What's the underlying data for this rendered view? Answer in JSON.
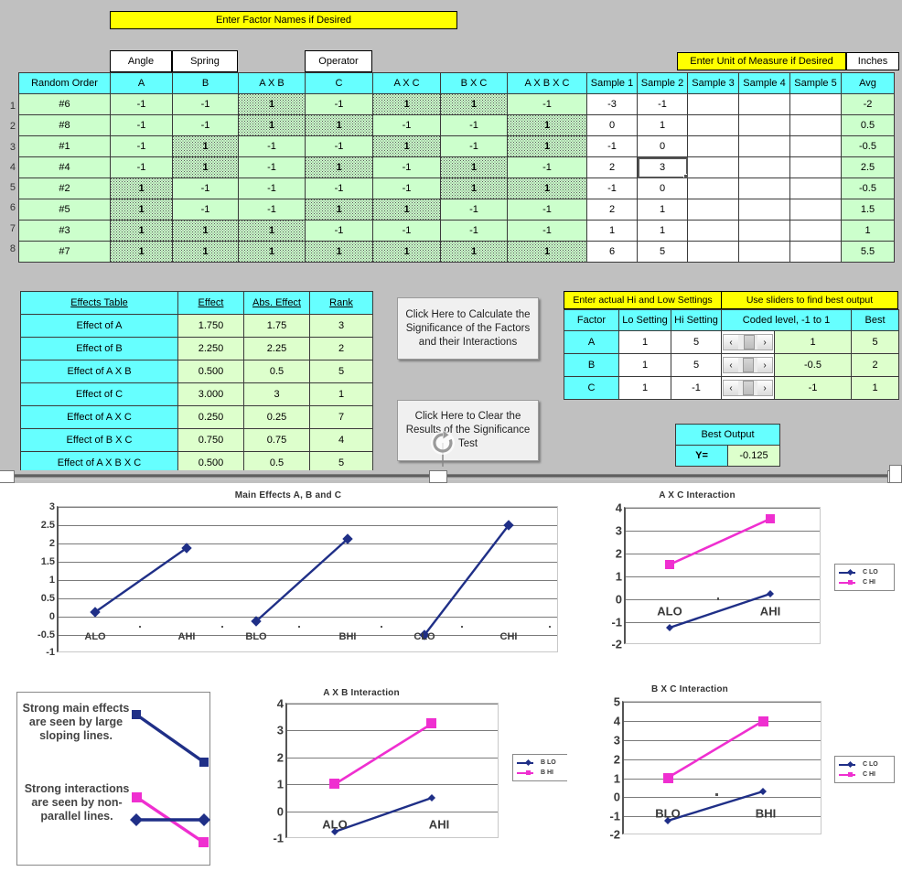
{
  "sheet": {
    "factor_names_banner": "Enter Factor Names if Desired",
    "unit_banner": "Enter Unit of Measure if Desired",
    "unit_value": "Inches",
    "factor_names": {
      "a": "Angle",
      "b": "Spring",
      "c": "Operator"
    },
    "columns": [
      "Random Order",
      "A",
      "B",
      "A X B",
      "C",
      "A X C",
      "B X C",
      "A X B X C",
      "Sample 1",
      "Sample 2",
      "Sample 3",
      "Sample 4",
      "Sample 5",
      "Avg"
    ],
    "row_numbers": [
      "1",
      "2",
      "3",
      "4",
      "5",
      "6",
      "7",
      "8"
    ],
    "rows": [
      {
        "order": "#6",
        "a": "-1",
        "b": "-1",
        "ab": "1",
        "c": "-1",
        "ac": "1",
        "bc": "1",
        "abc": "-1",
        "s1": "-3",
        "s2": "-1",
        "s3": "",
        "s4": "",
        "s5": "",
        "avg": "-2"
      },
      {
        "order": "#8",
        "a": "-1",
        "b": "-1",
        "ab": "1",
        "c": "1",
        "ac": "-1",
        "bc": "-1",
        "abc": "1",
        "s1": "0",
        "s2": "1",
        "s3": "",
        "s4": "",
        "s5": "",
        "avg": "0.5"
      },
      {
        "order": "#1",
        "a": "-1",
        "b": "1",
        "ab": "-1",
        "c": "-1",
        "ac": "1",
        "bc": "-1",
        "abc": "1",
        "s1": "-1",
        "s2": "0",
        "s3": "",
        "s4": "",
        "s5": "",
        "avg": "-0.5"
      },
      {
        "order": "#4",
        "a": "-1",
        "b": "1",
        "ab": "-1",
        "c": "1",
        "ac": "-1",
        "bc": "1",
        "abc": "-1",
        "s1": "2",
        "s2": "3",
        "s3": "",
        "s4": "",
        "s5": "",
        "avg": "2.5"
      },
      {
        "order": "#2",
        "a": "1",
        "b": "-1",
        "ab": "-1",
        "c": "-1",
        "ac": "-1",
        "bc": "1",
        "abc": "1",
        "s1": "-1",
        "s2": "0",
        "s3": "",
        "s4": "",
        "s5": "",
        "avg": "-0.5"
      },
      {
        "order": "#5",
        "a": "1",
        "b": "-1",
        "ab": "-1",
        "c": "1",
        "ac": "1",
        "bc": "-1",
        "abc": "-1",
        "s1": "2",
        "s2": "1",
        "s3": "",
        "s4": "",
        "s5": "",
        "avg": "1.5"
      },
      {
        "order": "#3",
        "a": "1",
        "b": "1",
        "ab": "1",
        "c": "-1",
        "ac": "-1",
        "bc": "-1",
        "abc": "-1",
        "s1": "1",
        "s2": "1",
        "s3": "",
        "s4": "",
        "s5": "",
        "avg": "1"
      },
      {
        "order": "#7",
        "a": "1",
        "b": "1",
        "ab": "1",
        "c": "1",
        "ac": "1",
        "bc": "1",
        "abc": "1",
        "s1": "6",
        "s2": "5",
        "s3": "",
        "s4": "",
        "s5": "",
        "avg": "5.5"
      }
    ],
    "selected_cell": {
      "row": 4,
      "column": "Sample 2",
      "value": "3"
    }
  },
  "effects_table": {
    "headers": [
      "Effects Table",
      "Effect",
      "Abs. Effect",
      "Rank"
    ],
    "rows": [
      {
        "label": "Effect of  A",
        "effect": "1.750",
        "abs": "1.75",
        "rank": "3"
      },
      {
        "label": "Effect of  B",
        "effect": "2.250",
        "abs": "2.25",
        "rank": "2"
      },
      {
        "label": "Effect of  A X B",
        "effect": "0.500",
        "abs": "0.5",
        "rank": "5"
      },
      {
        "label": "Effect of  C",
        "effect": "3.000",
        "abs": "3",
        "rank": "1"
      },
      {
        "label": "Effect of  A X C",
        "effect": "0.250",
        "abs": "0.25",
        "rank": "7"
      },
      {
        "label": "Effect of  B X C",
        "effect": "0.750",
        "abs": "0.75",
        "rank": "4"
      },
      {
        "label": "Effect of  A X B X C",
        "effect": "0.500",
        "abs": "0.5",
        "rank": "5"
      }
    ]
  },
  "buttons": {
    "calculate": "Click Here to Calculate the Significance of the Factors and their Interactions",
    "clear": "Click Here to Clear the Results of the Significance Test"
  },
  "settings": {
    "banner_left": "Enter actual Hi and Low Settings",
    "banner_right": "Use sliders to find best output",
    "headers": [
      "Factor",
      "Lo Setting",
      "Hi Setting",
      "Coded level, -1 to 1",
      "Best"
    ],
    "rows": [
      {
        "factor": "A",
        "lo": "1",
        "hi": "5",
        "coded": "1",
        "best": "5"
      },
      {
        "factor": "B",
        "lo": "1",
        "hi": "5",
        "coded": "-0.5",
        "best": "2"
      },
      {
        "factor": "C",
        "lo": "1",
        "hi": "-1",
        "coded": "-1",
        "best": "1"
      }
    ],
    "slider_icons": {
      "left": "‹",
      "right": "›"
    }
  },
  "best_output": {
    "title": "Best Output",
    "label": "Y=",
    "value": "-0.125"
  },
  "note_box": {
    "line1": "Strong main effects are seen by large sloping lines.",
    "line2": "Strong interactions are seen by non-parallel lines."
  },
  "colors": {
    "series_lo": "#1f2f87",
    "series_hi": "#ef2fd0",
    "header_cyan": "#66ffff",
    "cell_green": "#ccffcc",
    "banner_yellow": "#ffff00",
    "app_gray": "#c0c0c0"
  },
  "chart_data": [
    {
      "type": "line",
      "title": "Main Effects A, B and C",
      "xlabel": "",
      "ylabel": "",
      "ylim": [
        -1,
        3
      ],
      "yticks": [
        -1,
        -0.5,
        0,
        0.5,
        1,
        1.5,
        2,
        2.5,
        3
      ],
      "ytick_labels": [
        "-1",
        "-0.5",
        "0",
        "0.5",
        "1",
        "1.5",
        "2",
        "2.5",
        "3"
      ],
      "grid": true,
      "legend": "none",
      "categories": [
        "ALO",
        "AHI",
        "BLO",
        "BHI",
        "CLO",
        "CHI"
      ],
      "series": [
        {
          "name": "A",
          "color": "#1f2f87",
          "x": [
            "ALO",
            "AHI"
          ],
          "values": [
            0.125,
            1.875
          ]
        },
        {
          "name": "B",
          "color": "#1f2f87",
          "x": [
            "BLO",
            "BHI"
          ],
          "values": [
            -0.125,
            2.125
          ]
        },
        {
          "name": "C",
          "color": "#1f2f87",
          "x": [
            "CLO",
            "CHI"
          ],
          "values": [
            -0.5,
            2.5
          ]
        }
      ]
    },
    {
      "type": "line",
      "title": "A X C Interaction",
      "xlabel": "",
      "ylabel": "",
      "ylim": [
        -2,
        4
      ],
      "yticks": [
        -2,
        -1,
        0,
        1,
        2,
        3,
        4
      ],
      "ytick_labels": [
        "-2",
        "-1",
        "0",
        "1",
        "2",
        "3",
        "4"
      ],
      "grid": true,
      "legend": "right",
      "categories": [
        "ALO",
        "AHI"
      ],
      "series": [
        {
          "name": "C LO",
          "color": "#1f2f87",
          "values": [
            -1.25,
            0.25
          ]
        },
        {
          "name": "C HI",
          "color": "#ef2fd0",
          "values": [
            1.5,
            3.5
          ]
        }
      ]
    },
    {
      "type": "line",
      "title": "A X B Interaction",
      "xlabel": "",
      "ylabel": "",
      "ylim": [
        -1,
        4
      ],
      "yticks": [
        -1,
        0,
        1,
        2,
        3,
        4
      ],
      "ytick_labels": [
        "-1",
        "0",
        "1",
        "2",
        "3",
        "4"
      ],
      "grid": true,
      "legend": "right",
      "categories": [
        "ALO",
        "AHI"
      ],
      "series": [
        {
          "name": "B LO",
          "color": "#1f2f87",
          "values": [
            -0.75,
            0.5
          ]
        },
        {
          "name": "B HI",
          "color": "#ef2fd0",
          "values": [
            1.0,
            3.25
          ]
        }
      ]
    },
    {
      "type": "line",
      "title": "B X C Interaction",
      "xlabel": "",
      "ylabel": "",
      "ylim": [
        -2,
        5
      ],
      "yticks": [
        -2,
        -1,
        0,
        1,
        2,
        3,
        4,
        5
      ],
      "ytick_labels": [
        "-2",
        "-1",
        "0",
        "1",
        "2",
        "3",
        "4",
        "5"
      ],
      "grid": true,
      "legend": "right",
      "categories": [
        "BLO",
        "BHI"
      ],
      "series": [
        {
          "name": "C LO",
          "color": "#1f2f87",
          "values": [
            -1.25,
            0.25
          ]
        },
        {
          "name": "C HI",
          "color": "#ef2fd0",
          "values": [
            1.0,
            4.0
          ]
        }
      ]
    }
  ]
}
